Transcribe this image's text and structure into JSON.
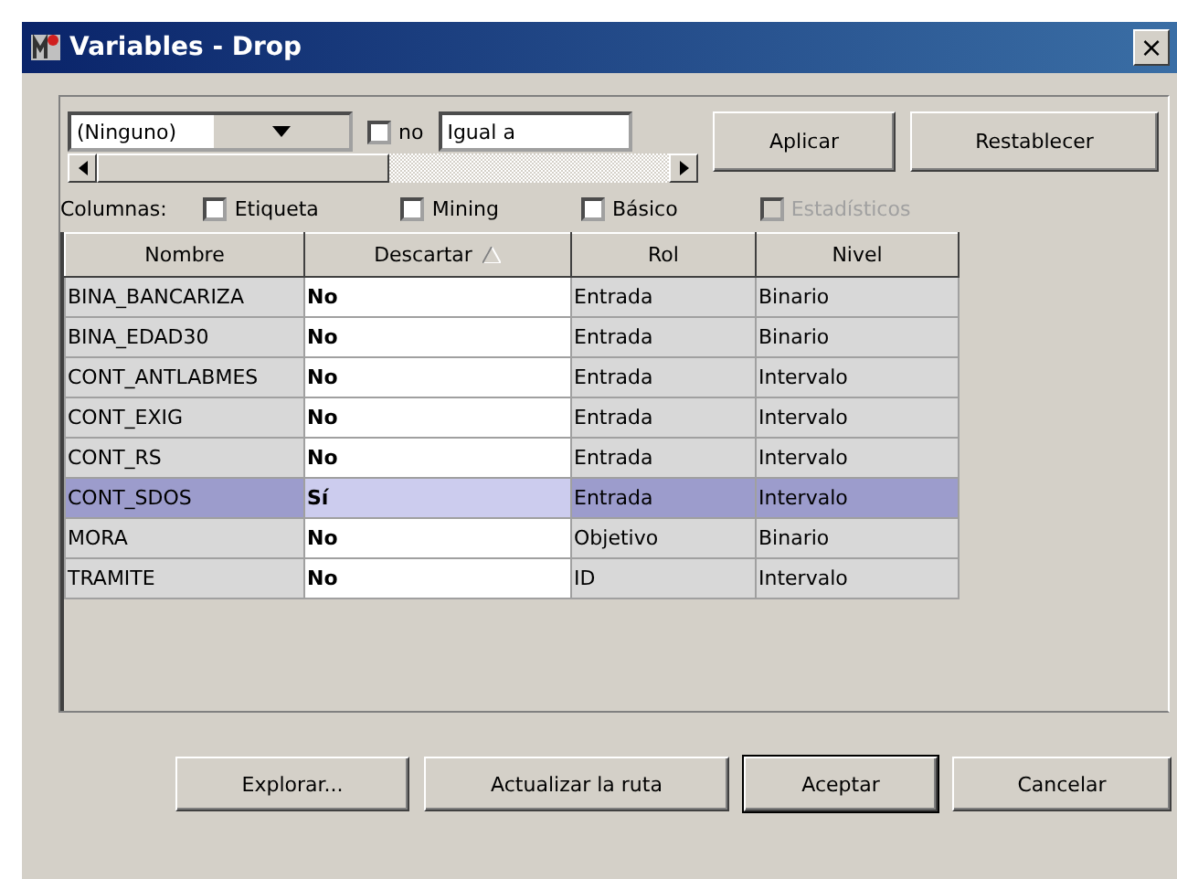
{
  "window": {
    "title": "Variables - Drop",
    "close": "×"
  },
  "filter": {
    "variable": "(Ninguno)",
    "negate": {
      "label": "no",
      "checked": false
    },
    "operator": "Igual a",
    "buttons": [
      "Aplicar",
      "Restablecer"
    ]
  },
  "columns_options": {
    "label": "Columnas:",
    "items": [
      {
        "label": "Etiqueta",
        "checked": false,
        "disabled": false
      },
      {
        "label": "Mining",
        "checked": false,
        "disabled": false
      },
      {
        "label": "Básico",
        "checked": false,
        "disabled": false
      },
      {
        "label": "Estadísticos",
        "checked": false,
        "disabled": true
      }
    ]
  },
  "table": {
    "columns": [
      {
        "label": "Nombre",
        "sorted": false
      },
      {
        "label": "Descartar",
        "sorted": true
      },
      {
        "label": "Rol",
        "sorted": false
      },
      {
        "label": "Nivel",
        "sorted": false
      }
    ],
    "rows": [
      {
        "nombre": "BINA_BANCARIZA",
        "descartar": "No",
        "rol": "Entrada",
        "nivel": "Binario",
        "selected": false
      },
      {
        "nombre": "BINA_EDAD30",
        "descartar": "No",
        "rol": "Entrada",
        "nivel": "Binario",
        "selected": false
      },
      {
        "nombre": "CONT_ANTLABMES",
        "descartar": "No",
        "rol": "Entrada",
        "nivel": "Intervalo",
        "selected": false
      },
      {
        "nombre": "CONT_EXIG",
        "descartar": "No",
        "rol": "Entrada",
        "nivel": "Intervalo",
        "selected": false
      },
      {
        "nombre": "CONT_RS",
        "descartar": "No",
        "rol": "Entrada",
        "nivel": "Intervalo",
        "selected": false
      },
      {
        "nombre": "CONT_SDOS",
        "descartar": "Sí",
        "rol": "Entrada",
        "nivel": "Intervalo",
        "selected": true
      },
      {
        "nombre": "MORA",
        "descartar": "No",
        "rol": "Objetivo",
        "nivel": "Binario",
        "selected": false
      },
      {
        "nombre": "TRAMITE",
        "descartar": "No",
        "rol": "ID",
        "nivel": "Intervalo",
        "selected": false
      }
    ]
  },
  "buttons": [
    {
      "label": "Explorar...",
      "default": false
    },
    {
      "label": "Actualizar la ruta",
      "default": false
    },
    {
      "label": "Aceptar",
      "default": true
    },
    {
      "label": "Cancelar",
      "default": false
    }
  ]
}
